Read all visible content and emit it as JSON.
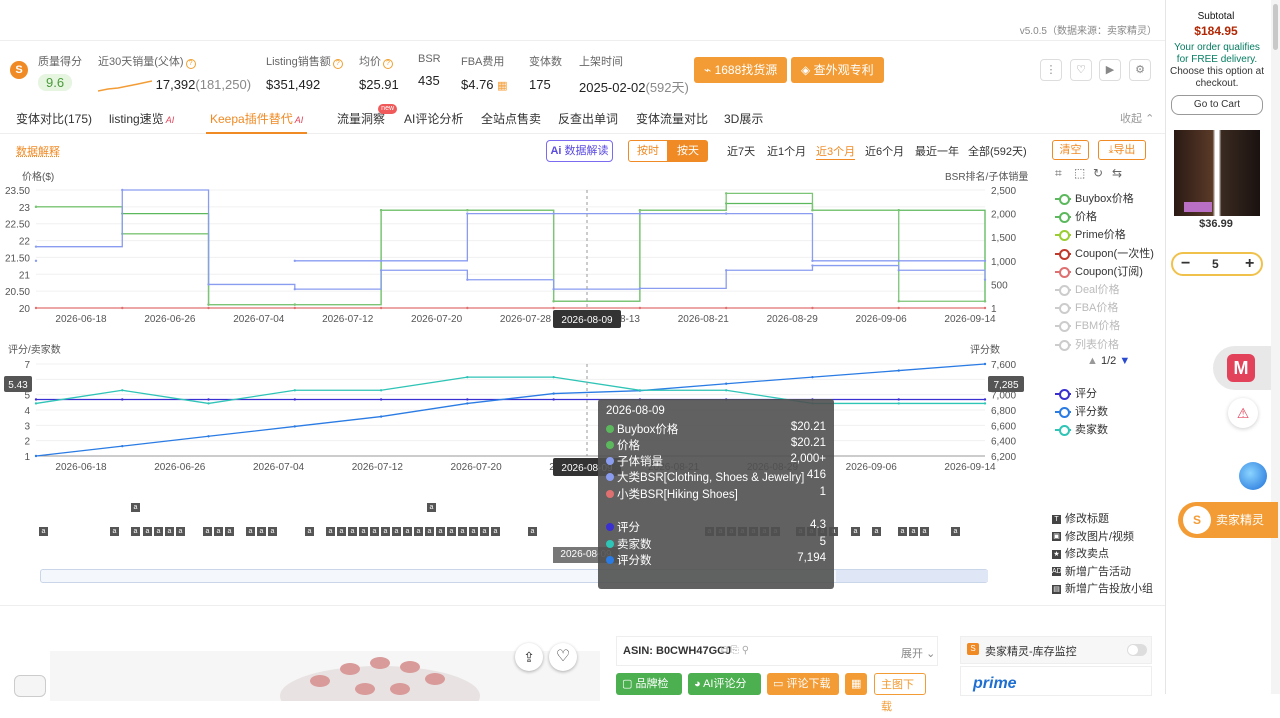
{
  "version_text": "v5.0.5（数据来源：卖家精灵）",
  "metrics": {
    "quality_label": "质量得分",
    "quality_value": "9.6",
    "sales30_label": "近30天销量(父体)",
    "sales30_value": "17,392",
    "sales30_parent": "(181,250)",
    "revenue_label": "Listing销售额",
    "revenue_value": "$351,492",
    "avg_price_label": "均价",
    "avg_price_value": "$25.91",
    "bsr_label": "BSR",
    "bsr_value": "435",
    "fba_label": "FBA费用",
    "fba_value": "$4.76",
    "variants_label": "变体数",
    "variants_value": "175",
    "listed_label": "上架时间",
    "listed_value": "2025-02-02",
    "listed_days": "(592天)"
  },
  "actions": {
    "source_1688": "1688找货源",
    "design_patent": "查外观专利"
  },
  "tabs": [
    {
      "label": "变体对比(175)"
    },
    {
      "label": "listing速览",
      "ai": "AI"
    },
    {
      "label": "Keepa插件替代",
      "ai": "AI",
      "active": true
    },
    {
      "label": "流量洞察",
      "badge": "new"
    },
    {
      "label": "AI评论分析"
    },
    {
      "label": "全站点售卖"
    },
    {
      "label": "反查出单词"
    },
    {
      "label": "变体流量对比"
    },
    {
      "label": "3D展示"
    }
  ],
  "collapse_label": "收起",
  "toolbar": {
    "data_explain": "数据解释",
    "ai_read": "数据解读",
    "by_hour": "按时",
    "by_day": "按天",
    "ranges": [
      "近7天",
      "近1个月",
      "近3个月",
      "近6个月",
      "最近一年",
      "全部(592天)"
    ],
    "active_range": "近3个月",
    "clear": "清空",
    "export": "导出"
  },
  "chart_top": {
    "ylabel_left": "价格($)",
    "ylabel_right": "BSR排名/子体销量",
    "y_left_ticks": [
      "23.50",
      "23",
      "22.50",
      "22",
      "21.50",
      "21",
      "20.50",
      "20"
    ],
    "y_right_ticks": [
      "2,500",
      "2,000",
      "1,500",
      "1,000",
      "500",
      "1"
    ],
    "x_ticks": [
      "2026-06-18",
      "2026-06-26",
      "2026-07-04",
      "2026-07-12",
      "2026-07-20",
      "2026-07-28",
      "2026-08-13",
      "2026-08-21",
      "2026-08-29",
      "2026-09-06",
      "2026-09-14"
    ],
    "cursor_label": "2026-08-09"
  },
  "chart_bottom": {
    "ylabel_left": "评分/卖家数",
    "ylabel_right": "评分数",
    "y_left_ticks": [
      "7",
      "6",
      "5",
      "4",
      "3",
      "2",
      "1"
    ],
    "y_right_ticks": [
      "7,600",
      "7,400",
      "7,000",
      "6,800",
      "6,600",
      "6,400",
      "6,200"
    ],
    "x_ticks": [
      "2026-06-18",
      "2026-06-26",
      "2026-07-04",
      "2026-07-12",
      "2026-07-20",
      "2026-07-28",
      "2026-08-21",
      "2026-08-29",
      "2026-09-06",
      "2026-09-14"
    ],
    "cursor_left_value": "5.43",
    "cursor_right_value": "7,285",
    "cursor_label": "2026-08-09"
  },
  "legend_top": [
    {
      "label": "Buybox价格",
      "color": "#5cb85c",
      "dim": false
    },
    {
      "label": "价格",
      "color": "#5cb85c",
      "dim": false
    },
    {
      "label": "Prime价格",
      "color": "#9acd32",
      "dim": false
    },
    {
      "label": "Coupon(一次性)",
      "color": "#c0392b",
      "dim": false
    },
    {
      "label": "Coupon(订阅)",
      "color": "#e07070",
      "dim": false
    },
    {
      "label": "Deal价格",
      "color": "#ccc",
      "dim": true
    },
    {
      "label": "FBA价格",
      "color": "#ccc",
      "dim": true
    },
    {
      "label": "FBM价格",
      "color": "#ccc",
      "dim": true
    },
    {
      "label": "列表价格",
      "color": "#ccc",
      "dim": true
    }
  ],
  "legend_pager": "1/2",
  "legend_bottom": [
    {
      "label": "评分",
      "color": "#3a2fd1"
    },
    {
      "label": "评分数",
      "color": "#2a7be4"
    },
    {
      "label": "卖家数",
      "color": "#2ec4b6"
    }
  ],
  "tooltip": {
    "date": "2026-08-09",
    "rows": [
      {
        "label": "Buybox价格",
        "value": "$20.21",
        "color": "#5cb85c"
      },
      {
        "label": "价格",
        "value": "$20.21",
        "color": "#5cb85c"
      },
      {
        "label": "子体销量",
        "value": "2,000+",
        "color": "#8a9cf0"
      },
      {
        "label": "大类BSR[Clothing, Shoes & Jewelry]",
        "value": "416",
        "color": "#8a9cf0"
      },
      {
        "label": "小类BSR[Hiking Shoes]",
        "value": "1",
        "color": "#e07070"
      },
      {
        "label": "评分",
        "value": "4.3",
        "color": "#3a2fd1"
      },
      {
        "label": "卖家数",
        "value": "5",
        "color": "#2ec4b6"
      },
      {
        "label": "评分数",
        "value": "7,194",
        "color": "#2a7be4"
      }
    ]
  },
  "events": [
    {
      "label": "修改标题",
      "icon": "T"
    },
    {
      "label": "修改图片/视频",
      "icon": "▣"
    },
    {
      "label": "修改卖点",
      "icon": "★"
    },
    {
      "label": "新增广告活动",
      "icon": "AD"
    },
    {
      "label": "新增广告投放小组",
      "icon": "▤"
    }
  ],
  "bottom": {
    "asin": "ASIN: B0CWH47GCJ",
    "expand": "展开",
    "brand_check": "品牌检测",
    "ai_review": "AI评论分析",
    "review_download": "评论下载",
    "keyword_download": "主图下载",
    "inventory_monitor": "卖家精灵-库存监控",
    "prime": "prime"
  },
  "sidebar": {
    "subtotal_label": "Subtotal",
    "subtotal_value": "$184.95",
    "free_delivery": "Your order qualifies for FREE delivery.",
    "choose_option": "Choose this option at checkout.",
    "go_to_cart": "Go to Cart",
    "product_price": "$36.99",
    "quantity": "5",
    "seller_sprite": "卖家精灵"
  },
  "chart_data": [
    {
      "type": "line",
      "title": "",
      "xlabel": "",
      "ylabel": "价格($)",
      "ylabel_right": "BSR排名/子体销量",
      "x": [
        "2026-06-18",
        "2026-06-26",
        "2026-07-04",
        "2026-07-12",
        "2026-07-20",
        "2026-07-28",
        "2026-08-05",
        "2026-08-13",
        "2026-08-21",
        "2026-08-29",
        "2026-09-06",
        "2026-09-14"
      ],
      "ylim": [
        20,
        23.5
      ],
      "ylim_right": [
        1,
        2500
      ],
      "series": [
        {
          "name": "价格",
          "values": [
            23,
            22.8,
            20.1,
            20.1,
            22.9,
            22.9,
            20.2,
            22.9,
            23.1,
            22.9,
            22.9,
            20.2
          ]
        },
        {
          "name": "Buybox价格",
          "values": [
            23,
            22.2,
            20.1,
            20.1,
            22.9,
            22.9,
            20.2,
            22.9,
            23.4,
            22.9,
            20.2,
            20.2
          ]
        },
        {
          "name": "Coupon(订阅)",
          "values": [
            20,
            20,
            20,
            20,
            20,
            20,
            20,
            20,
            20,
            20,
            20,
            20
          ]
        },
        {
          "name": "子体销量",
          "values": [
            1000,
            null,
            null,
            1000,
            1000,
            2000,
            2000,
            2000,
            2000,
            1000,
            1000,
            1000
          ]
        },
        {
          "name": "大类BSR[Clothing, Shoes & Jewelry]",
          "values": [
            1300,
            2500,
            500,
            400,
            800,
            600,
            400,
            416,
            800,
            900,
            800,
            600
          ]
        }
      ]
    },
    {
      "type": "line",
      "title": "",
      "xlabel": "",
      "ylabel": "评分/卖家数",
      "ylabel_right": "评分数",
      "x": [
        "2026-06-18",
        "2026-06-26",
        "2026-07-04",
        "2026-07-12",
        "2026-07-20",
        "2026-07-28",
        "2026-08-05",
        "2026-08-13",
        "2026-08-21",
        "2026-08-29",
        "2026-09-06",
        "2026-09-14"
      ],
      "ylim": [
        0,
        7
      ],
      "ylim_right": [
        6200,
        7600
      ],
      "series": [
        {
          "name": "评分",
          "values": [
            4.3,
            4.3,
            4.3,
            4.3,
            4.3,
            4.3,
            4.3,
            4.3,
            4.3,
            4.3,
            4.3,
            4.3
          ]
        },
        {
          "name": "评分数",
          "values": [
            6200,
            6350,
            6500,
            6650,
            6800,
            7000,
            7150,
            7194,
            7300,
            7400,
            7500,
            7600
          ]
        },
        {
          "name": "卖家数",
          "values": [
            4,
            5,
            4,
            5,
            5,
            6,
            6,
            5,
            5,
            4,
            4,
            4
          ]
        }
      ]
    }
  ]
}
